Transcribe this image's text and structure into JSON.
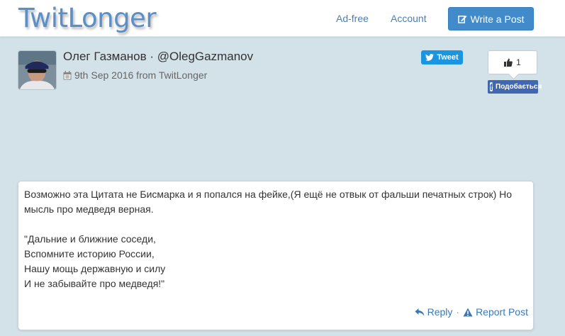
{
  "navbar": {
    "brand": "TwitLonger",
    "links": [
      {
        "label": "Ad-free"
      },
      {
        "label": "Account"
      }
    ],
    "write_button": "Write a Post"
  },
  "post_header": {
    "author": "Олег Газманов · @OlegGazmanov",
    "meta": "9th Sep 2016 from TwitLonger",
    "tweet_button": "Tweet",
    "like_count": "1",
    "fb_button": "Подобається"
  },
  "post": {
    "paragraph1": "Возможно эта Цитата не Бисмарка и я попался на фейке,(Я ещё не отвык от фальши печатных строк) Но мысль про медведя верная.",
    "quote_lines": [
      "\"Дальние и ближние соседи,",
      "Вспомните историю России,",
      "Нашу мощь державную и силу",
      "И не забывайте про медведя!\""
    ],
    "reply_label": "Reply",
    "separator": "·",
    "report_label": "Report Post"
  },
  "colors": {
    "background": "#d3e1e9",
    "brand": "#5d8fc7",
    "primary_button": "#428bca",
    "twitter": "#1b95e0",
    "facebook": "#4267b2",
    "link": "#3a78b5"
  },
  "icons": [
    "edit-icon",
    "calendar-icon",
    "twitter-bird-icon",
    "thumbs-up-icon",
    "facebook-icon",
    "reply-icon",
    "warning-icon"
  ]
}
